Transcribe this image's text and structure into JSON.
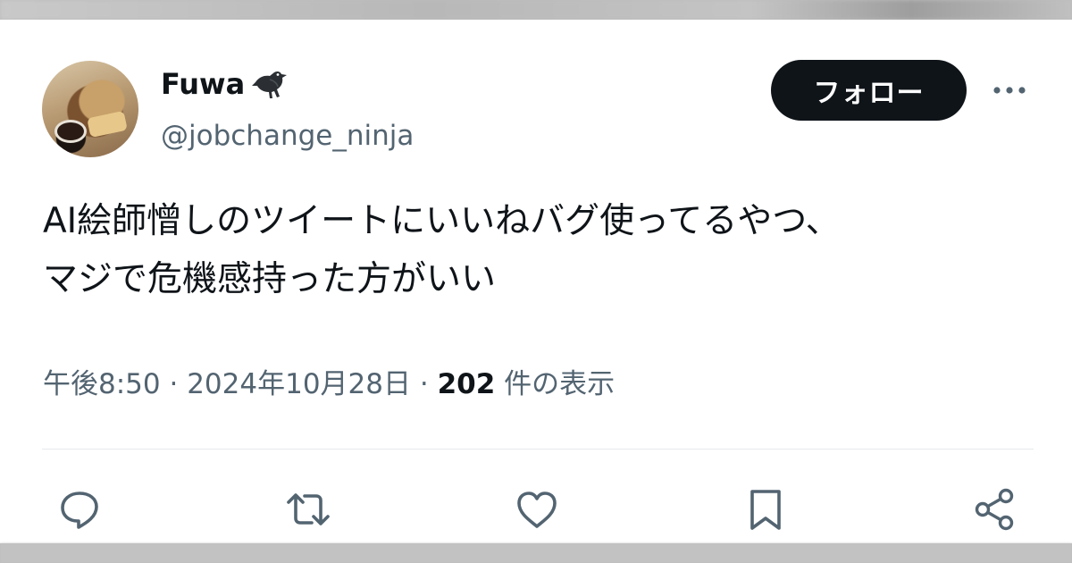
{
  "tweet": {
    "author": {
      "display_name": "Fuwa",
      "name_emoji_icon": "crow-icon",
      "handle": "@jobchange_ninja",
      "avatar_icon": "coffee-breakfast-avatar"
    },
    "follow_button_label": "フォロー",
    "more_icon": "more-horizontal-icon",
    "text_lines": [
      "AI絵師憎しのツイートにいいねバグ使ってるやつ、",
      "マジで危機感持った方がいい"
    ],
    "meta": {
      "time": "午後8:50",
      "separator": "·",
      "date": "2024年10月28日",
      "views_count": "202",
      "views_label": "件の表示"
    },
    "actions": [
      {
        "name": "reply",
        "icon": "reply-icon"
      },
      {
        "name": "retweet",
        "icon": "retweet-icon"
      },
      {
        "name": "like",
        "icon": "heart-icon"
      },
      {
        "name": "bookmark",
        "icon": "bookmark-icon"
      },
      {
        "name": "share",
        "icon": "share-icon"
      }
    ]
  },
  "colors": {
    "text_primary": "#0f1419",
    "text_secondary": "#536471",
    "button_bg": "#0f1419",
    "divider": "#e6e9ec",
    "action_icon": "#536471"
  }
}
